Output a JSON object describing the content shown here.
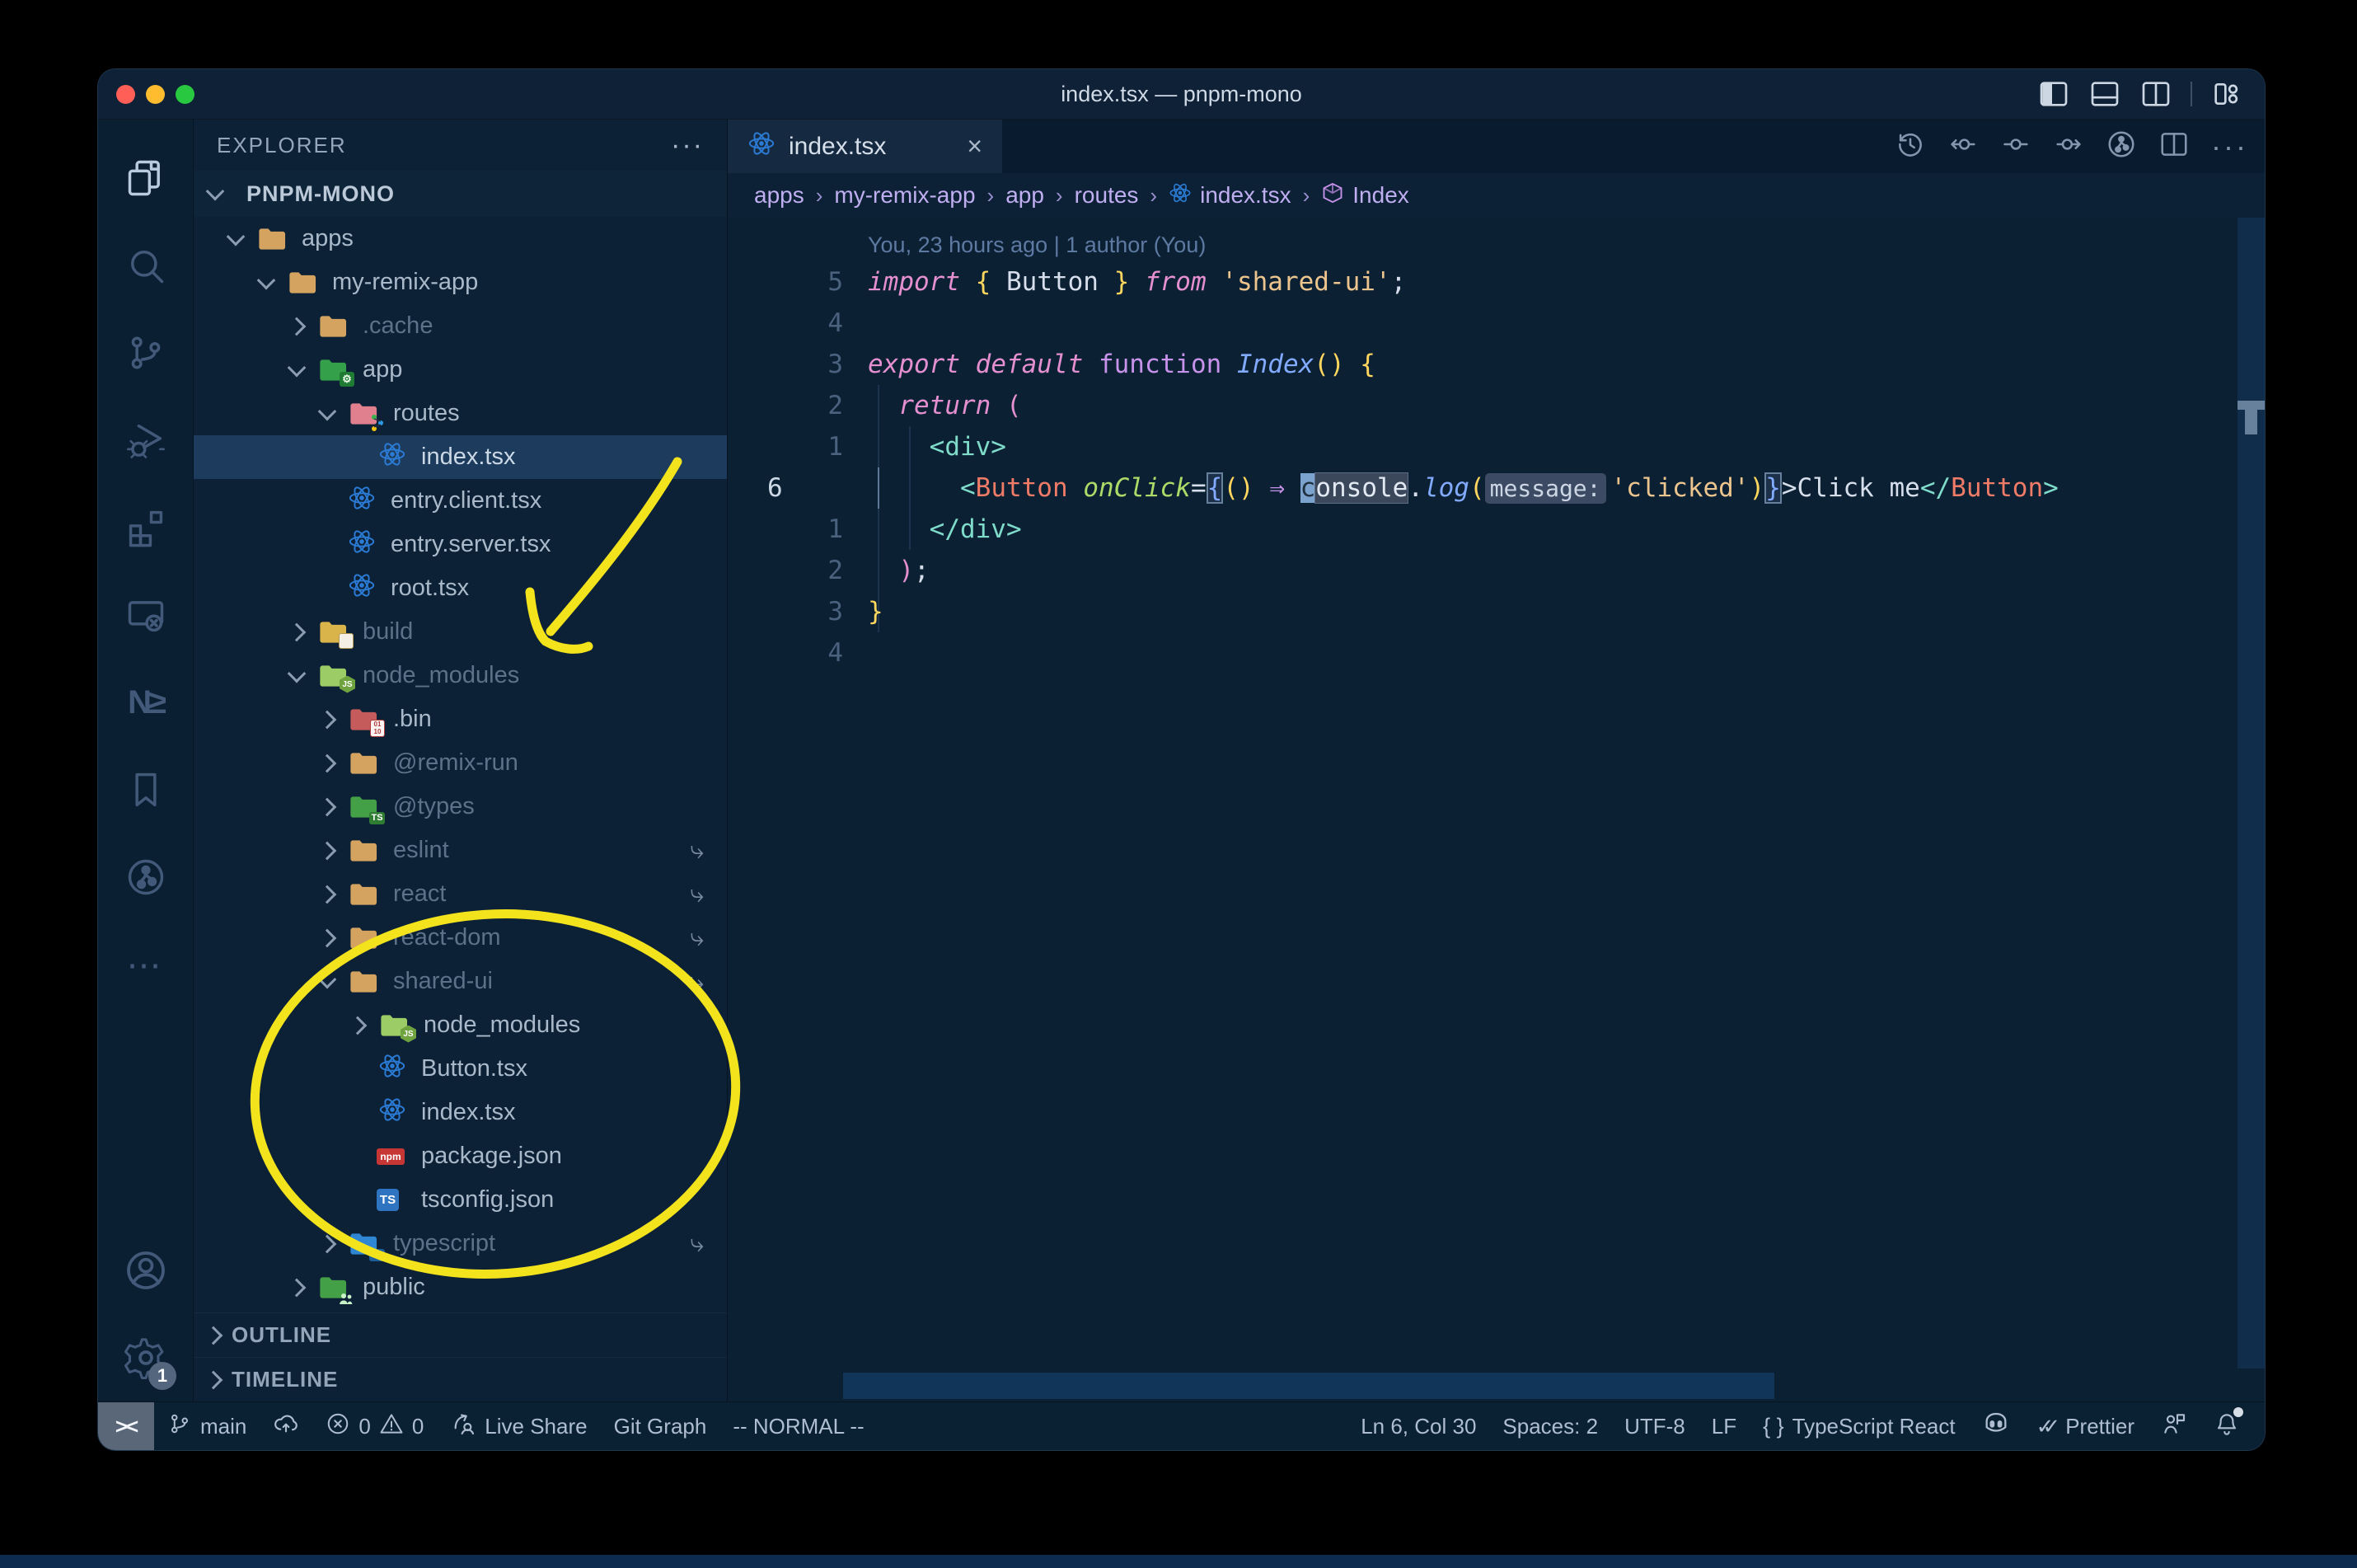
{
  "window": {
    "title": "index.tsx — pnpm-mono"
  },
  "titlebar_icons": [
    "panel-left-icon",
    "panel-bottom-icon",
    "panel-right-icon",
    "layout-customize-icon"
  ],
  "activity_bar": {
    "top": [
      {
        "icon": "files-icon",
        "active": true
      },
      {
        "icon": "search-icon"
      },
      {
        "icon": "source-control-icon"
      },
      {
        "icon": "run-debug-icon"
      },
      {
        "icon": "extensions-icon"
      },
      {
        "icon": "remote-explorer-icon"
      },
      {
        "icon": "nx-console-icon"
      },
      {
        "icon": "bookmarks-icon"
      },
      {
        "icon": "gitlens-icon"
      },
      {
        "icon": "more-views-icon"
      }
    ],
    "bottom": [
      {
        "icon": "account-icon"
      },
      {
        "icon": "settings-gear-icon",
        "badge": "1"
      }
    ]
  },
  "explorer": {
    "header": "EXPLORER",
    "header_more": "···",
    "project": "PNPM-MONO",
    "tree": [
      {
        "label": "apps",
        "level": 1,
        "chev": "down",
        "icon": "folder-tan"
      },
      {
        "label": "my-remix-app",
        "level": 2,
        "chev": "down",
        "icon": "folder-tan"
      },
      {
        "label": ".cache",
        "level": 3,
        "chev": "right",
        "icon": "folder-tan",
        "dim": true
      },
      {
        "label": "app",
        "level": 3,
        "chev": "down",
        "icon": "folder-app"
      },
      {
        "label": "routes",
        "level": 4,
        "chev": "down",
        "icon": "folder-routes"
      },
      {
        "label": "index.tsx",
        "level": 5,
        "chev": "none",
        "icon": "react",
        "selected": true
      },
      {
        "label": "entry.client.tsx",
        "level": 4,
        "chev": "none",
        "icon": "react"
      },
      {
        "label": "entry.server.tsx",
        "level": 4,
        "chev": "none",
        "icon": "react"
      },
      {
        "label": "root.tsx",
        "level": 4,
        "chev": "none",
        "icon": "react"
      },
      {
        "label": "build",
        "level": 3,
        "chev": "right",
        "icon": "folder-build",
        "dim": true
      },
      {
        "label": "node_modules",
        "level": 3,
        "chev": "down",
        "icon": "folder-node",
        "dim": true
      },
      {
        "label": ".bin",
        "level": 4,
        "chev": "right",
        "icon": "folder-bin"
      },
      {
        "label": "@remix-run",
        "level": 4,
        "chev": "right",
        "icon": "folder-tan",
        "dim": true
      },
      {
        "label": "@types",
        "level": 4,
        "chev": "right",
        "icon": "folder-types",
        "dim": true
      },
      {
        "label": "eslint",
        "level": 4,
        "chev": "right",
        "icon": "folder-tan",
        "dim": true,
        "symlink": true
      },
      {
        "label": "react",
        "level": 4,
        "chev": "right",
        "icon": "folder-tan",
        "dim": true,
        "symlink": true
      },
      {
        "label": "react-dom",
        "level": 4,
        "chev": "right",
        "icon": "folder-tan",
        "dim": true,
        "symlink": true
      },
      {
        "label": "shared-ui",
        "level": 4,
        "chev": "down",
        "icon": "folder-tan",
        "dim": true,
        "symlink": true
      },
      {
        "label": "node_modules",
        "level": 5,
        "chev": "right",
        "icon": "folder-node"
      },
      {
        "label": "Button.tsx",
        "level": 5,
        "chev": "none",
        "icon": "react"
      },
      {
        "label": "index.tsx",
        "level": 5,
        "chev": "none",
        "icon": "react"
      },
      {
        "label": "package.json",
        "level": 5,
        "chev": "none",
        "icon": "npm"
      },
      {
        "label": "tsconfig.json",
        "level": 5,
        "chev": "none",
        "icon": "ts"
      },
      {
        "label": "typescript",
        "level": 4,
        "chev": "right",
        "icon": "folder-ts",
        "dim": true,
        "symlink": true
      },
      {
        "label": "public",
        "level": 3,
        "chev": "right",
        "icon": "folder-public"
      }
    ],
    "sections": [
      "OUTLINE",
      "TIMELINE"
    ]
  },
  "tab": {
    "label": "index.tsx",
    "icon": "react-icon",
    "close": "×"
  },
  "editor_actions": [
    "timeline-history-icon",
    "prev-change-icon",
    "changes-icon",
    "next-change-icon",
    "gitlens-graph-icon",
    "split-editor-icon",
    "more-actions-icon"
  ],
  "breadcrumb": [
    {
      "label": "apps"
    },
    {
      "label": "my-remix-app"
    },
    {
      "label": "app"
    },
    {
      "label": "routes"
    },
    {
      "label": "index.tsx",
      "icon": "react"
    },
    {
      "label": "Index",
      "icon": "symbol-module"
    }
  ],
  "editor": {
    "blame": "You, 23 hours ago | 1 author (You)",
    "lines": [
      {
        "num": "5",
        "tokens": [
          {
            "t": "import",
            "c": "k"
          },
          {
            "t": " ",
            "c": "fg"
          },
          {
            "t": "{",
            "c": "y"
          },
          {
            "t": " Button ",
            "c": "fg"
          },
          {
            "t": "}",
            "c": "y"
          },
          {
            "t": " ",
            "c": "fg"
          },
          {
            "t": "from",
            "c": "k"
          },
          {
            "t": " ",
            "c": "fg"
          },
          {
            "t": "'shared-ui'",
            "c": "s"
          },
          {
            "t": ";",
            "c": "fg"
          }
        ]
      },
      {
        "num": "4",
        "tokens": []
      },
      {
        "num": "3",
        "tokens": [
          {
            "t": "export",
            "c": "k"
          },
          {
            "t": " ",
            "c": "fg"
          },
          {
            "t": "default",
            "c": "k"
          },
          {
            "t": " ",
            "c": "fg"
          },
          {
            "t": "function",
            "c": "kf"
          },
          {
            "t": " ",
            "c": "fg"
          },
          {
            "t": "Index",
            "c": "bl"
          },
          {
            "t": "()",
            "c": "y"
          },
          {
            "t": " ",
            "c": "fg"
          },
          {
            "t": "{",
            "c": "y"
          }
        ]
      },
      {
        "num": "2",
        "tokens": [
          {
            "t": "  ",
            "c": "fg"
          },
          {
            "t": "return",
            "c": "k"
          },
          {
            "t": " ",
            "c": "fg"
          },
          {
            "t": "(",
            "c": "p"
          }
        ]
      },
      {
        "num": "1",
        "tokens": [
          {
            "t": "    ",
            "c": "fg"
          },
          {
            "t": "<div>",
            "c": "t"
          }
        ]
      },
      {
        "num": "6",
        "current": true,
        "tokens": [
          {
            "t": "      ",
            "c": "fg"
          },
          {
            "t": "<",
            "c": "t"
          },
          {
            "t": "Button",
            "c": "comp"
          },
          {
            "t": " ",
            "c": "fg"
          },
          {
            "t": "onClick",
            "c": "attr"
          },
          {
            "t": "=",
            "c": "fg"
          },
          {
            "t": "{",
            "c": "bb"
          },
          {
            "t": "()",
            "c": "y"
          },
          {
            "t": " ",
            "c": "fg"
          },
          {
            "t": "⇒",
            "c": "arrow"
          },
          {
            "t": " ",
            "c": "fg"
          },
          {
            "t": "c",
            "c": "cur"
          },
          {
            "t": "onsole",
            "c": "whl"
          },
          {
            "t": ".",
            "c": "fg"
          },
          {
            "t": "log",
            "c": "bl"
          },
          {
            "t": "(",
            "c": "y"
          },
          {
            "t": "message:",
            "c": "inlay"
          },
          {
            "t": "'clicked'",
            "c": "s"
          },
          {
            "t": ")",
            "c": "y"
          },
          {
            "t": "}",
            "c": "bb"
          },
          {
            "t": ">",
            "c": "fg"
          },
          {
            "t": "Click me",
            "c": "fg"
          },
          {
            "t": "</",
            "c": "t"
          },
          {
            "t": "Button",
            "c": "comp"
          },
          {
            "t": ">",
            "c": "t"
          }
        ]
      },
      {
        "num": "1",
        "tokens": [
          {
            "t": "    ",
            "c": "fg"
          },
          {
            "t": "</div>",
            "c": "t"
          }
        ]
      },
      {
        "num": "2",
        "tokens": [
          {
            "t": "  ",
            "c": "fg"
          },
          {
            "t": ")",
            "c": "p"
          },
          {
            "t": ";",
            "c": "fg"
          }
        ]
      },
      {
        "num": "3",
        "tokens": [
          {
            "t": "}",
            "c": "y"
          }
        ]
      },
      {
        "num": "4",
        "tokens": []
      }
    ]
  },
  "status_bar": {
    "remote": "><",
    "left": [
      {
        "icon": "branch-icon",
        "label": "main"
      },
      {
        "icon": "publish-cloud-icon",
        "label": ""
      },
      {
        "icon": "error-icon",
        "label": "0",
        "icon2": "warning-icon",
        "label2": "0"
      },
      {
        "icon": "live-share-icon",
        "label": "Live Share"
      },
      {
        "icon": "",
        "label": "Git Graph"
      },
      {
        "icon": "",
        "label": "-- NORMAL --"
      }
    ],
    "right": [
      {
        "icon": "",
        "label": "Ln 6, Col 30"
      },
      {
        "icon": "",
        "label": "Spaces: 2"
      },
      {
        "icon": "",
        "label": "UTF-8"
      },
      {
        "icon": "",
        "label": "LF"
      },
      {
        "icon": "braces-icon",
        "label": "TypeScript React"
      },
      {
        "icon": "copilot-icon",
        "label": ""
      },
      {
        "icon": "prettier-check-icon",
        "label": "Prettier"
      },
      {
        "icon": "feedback-icon",
        "label": ""
      },
      {
        "icon": "bell-icon",
        "label": ""
      }
    ]
  },
  "annotation": {
    "color": "#f2e31c"
  }
}
